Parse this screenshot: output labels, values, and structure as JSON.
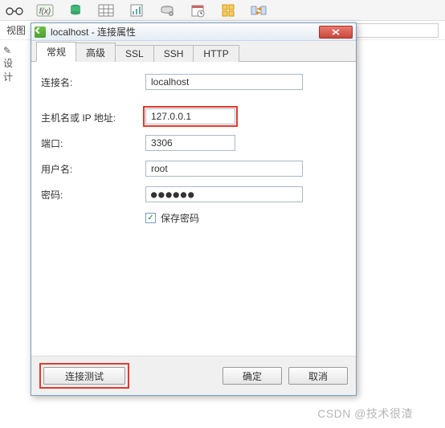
{
  "bg": {
    "view_label": "视图",
    "side_label": "设计"
  },
  "dialog": {
    "title": "localhost - 连接属性",
    "tabs": [
      "常规",
      "高级",
      "SSL",
      "SSH",
      "HTTP"
    ],
    "active_tab": 0,
    "fields": {
      "conn_name": {
        "label": "连接名:",
        "value": "localhost"
      },
      "host": {
        "label": "主机名或 IP 地址:",
        "value": "127.0.0.1"
      },
      "port": {
        "label": "端口:",
        "value": "3306"
      },
      "user": {
        "label": "用户名:",
        "value": "root"
      },
      "password": {
        "label": "密码:",
        "value": "●●●●●●"
      },
      "save_pw": {
        "label": "保存密码",
        "checked": true
      }
    },
    "buttons": {
      "test": "连接测试",
      "ok": "确定",
      "cancel": "取消"
    }
  },
  "watermark": "CSDN @技术很渣"
}
